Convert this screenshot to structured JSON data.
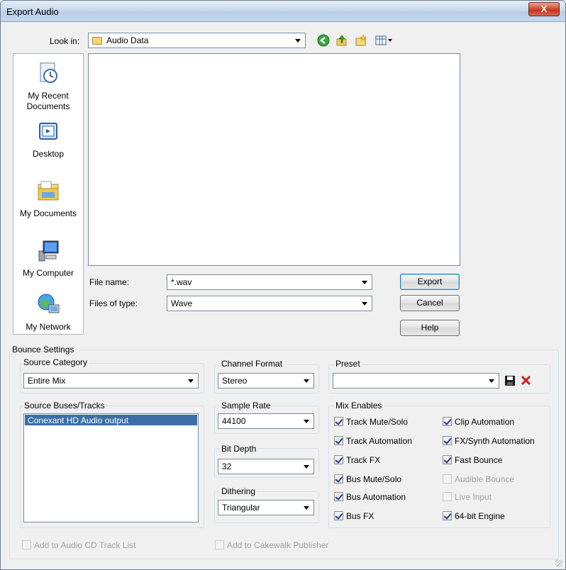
{
  "window": {
    "title": "Export Audio",
    "close_glyph": "X"
  },
  "lookin": {
    "label": "Look in:",
    "value": "Audio Data"
  },
  "toolbar": {
    "icons": [
      "back-icon",
      "up-folder-icon",
      "new-folder-icon",
      "view-menu-icon"
    ]
  },
  "places": [
    {
      "label": "My Recent Documents",
      "icon": "recent-documents-icon"
    },
    {
      "label": "Desktop",
      "icon": "desktop-icon"
    },
    {
      "label": "My Documents",
      "icon": "my-documents-icon"
    },
    {
      "label": "My Computer",
      "icon": "my-computer-icon"
    },
    {
      "label": "My Network",
      "icon": "my-network-icon"
    }
  ],
  "file": {
    "name_label": "File name:",
    "name_value": "*.wav",
    "type_label": "Files of type:",
    "type_value": "Wave"
  },
  "buttons": {
    "export": "Export",
    "cancel": "Cancel",
    "help": "Help"
  },
  "bounce": {
    "title": "Bounce Settings",
    "source_category": {
      "label": "Source Category",
      "value": "Entire Mix"
    },
    "channel_format": {
      "label": "Channel Format",
      "value": "Stereo"
    },
    "preset": {
      "label": "Preset",
      "value": ""
    },
    "source_tracks": {
      "label": "Source Buses/Tracks",
      "items": [
        "Conexant HD Audio output"
      ]
    },
    "sample_rate": {
      "label": "Sample Rate",
      "value": "44100"
    },
    "bit_depth": {
      "label": "Bit Depth",
      "value": "32"
    },
    "dithering": {
      "label": "Dithering",
      "value": "Triangular"
    },
    "mix_enables": {
      "label": "Mix Enables",
      "left": [
        {
          "label": "Track Mute/Solo",
          "checked": true,
          "enabled": true
        },
        {
          "label": "Track Automation",
          "checked": true,
          "enabled": true
        },
        {
          "label": "Track FX",
          "checked": true,
          "enabled": true
        },
        {
          "label": "Bus Mute/Solo",
          "checked": true,
          "enabled": true
        },
        {
          "label": "Bus Automation",
          "checked": true,
          "enabled": true
        },
        {
          "label": "Bus FX",
          "checked": true,
          "enabled": true
        }
      ],
      "right": [
        {
          "label": "Clip Automation",
          "checked": true,
          "enabled": true
        },
        {
          "label": "FX/Synth Automation",
          "checked": true,
          "enabled": true
        },
        {
          "label": "Fast Bounce",
          "checked": true,
          "enabled": true
        },
        {
          "label": "Audible Bounce",
          "checked": false,
          "enabled": false
        },
        {
          "label": "Live Input",
          "checked": false,
          "enabled": false
        },
        {
          "label": "64-bit Engine",
          "checked": true,
          "enabled": true
        }
      ]
    },
    "add_cd": {
      "label": "Add to Audio CD Track List",
      "checked": false,
      "enabled": false
    },
    "add_publisher": {
      "label": "Add to Cakewalk Publisher",
      "checked": false,
      "enabled": false
    }
  },
  "colors": {
    "selection": "#3a6ea5",
    "close": "#c0341c",
    "titlebar": "#c9daee"
  }
}
